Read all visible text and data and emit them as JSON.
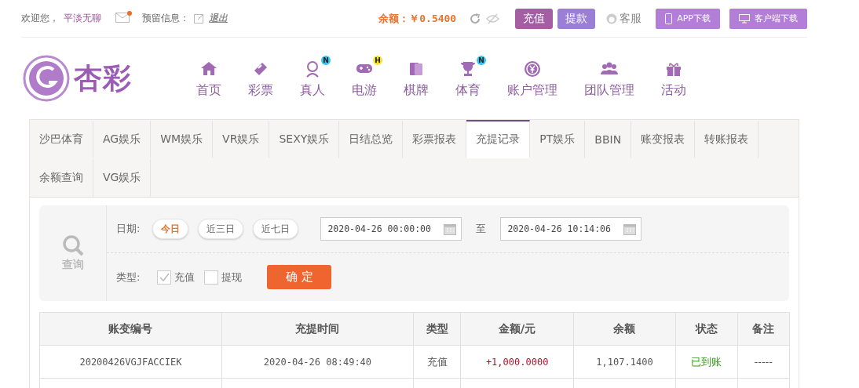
{
  "top_bar": {
    "welcome": "欢迎您，",
    "username": "平淡无聊",
    "has_new_mail": true,
    "reserved_info_label": "预留信息：",
    "logout": "退出",
    "balance": "余额：￥0.5400",
    "buttons": [
      {
        "label": "充值",
        "kind": "deposit"
      },
      {
        "label": "提款",
        "kind": "withdraw"
      }
    ],
    "service": "客服",
    "downloads": [
      {
        "label": "APP下载",
        "kind": "phone"
      },
      {
        "label": "客户端下载",
        "kind": "desktop"
      }
    ]
  },
  "header": {
    "logo_text": "杏彩",
    "nav": [
      {
        "label": "首页",
        "kind": "home"
      },
      {
        "label": "彩票",
        "kind": "ticket"
      },
      {
        "label": "真人",
        "kind": "person",
        "badge": "N",
        "color": "#3fc3ee"
      },
      {
        "label": "电游",
        "kind": "gamepad",
        "badge": "H",
        "color": "#f5e13a"
      },
      {
        "label": "棋牌",
        "kind": "cards"
      },
      {
        "label": "体育",
        "kind": "trophy",
        "badge": "N",
        "color": "#3fc3ee"
      },
      {
        "label": "账户管理",
        "kind": "coin"
      },
      {
        "label": "团队管理",
        "kind": "team"
      },
      {
        "label": "活动",
        "kind": "gift"
      }
    ]
  },
  "tabs": [
    {
      "label": "沙巴体育",
      "selected": false
    },
    {
      "label": "AG娱乐",
      "selected": false
    },
    {
      "label": "WM娱乐",
      "selected": false
    },
    {
      "label": "VR娱乐",
      "selected": false
    },
    {
      "label": "SEXY娱乐",
      "selected": false
    },
    {
      "label": "日结总览",
      "selected": false
    },
    {
      "label": "彩票报表",
      "selected": false
    },
    {
      "label": "充提记录",
      "selected": true
    },
    {
      "label": "PT娱乐",
      "selected": false
    },
    {
      "label": "BBIN",
      "selected": false
    },
    {
      "label": "账变报表",
      "selected": false
    },
    {
      "label": "转账报表",
      "selected": false
    },
    {
      "label": "余额查询",
      "selected": false
    },
    {
      "label": "VG娱乐",
      "selected": false
    }
  ],
  "filter": {
    "query_label": "查询",
    "date_label": "日期:",
    "ranges": [
      {
        "label": "今日",
        "selected": true
      },
      {
        "label": "近三日",
        "selected": false
      },
      {
        "label": "近七日",
        "selected": false
      }
    ],
    "start": "2020-04-26 00:00:00",
    "to": "至",
    "end": "2020-04-26 10:14:06",
    "type_label": "类型:",
    "types": [
      {
        "label": "充值",
        "checked": true
      },
      {
        "label": "提现",
        "checked": false
      }
    ],
    "confirm": "确 定"
  },
  "table": {
    "columns": [
      "账变编号",
      "充提时间",
      "类型",
      "金额/元",
      "余额",
      "状态",
      "备注"
    ],
    "rows": [
      {
        "cells": [
          "20200426VGJFACCIEK",
          "2020-04-26 08:49:40",
          "充值",
          "+1,000.0000",
          "1,107.1400",
          "已到账",
          "-----"
        ]
      }
    ]
  }
}
